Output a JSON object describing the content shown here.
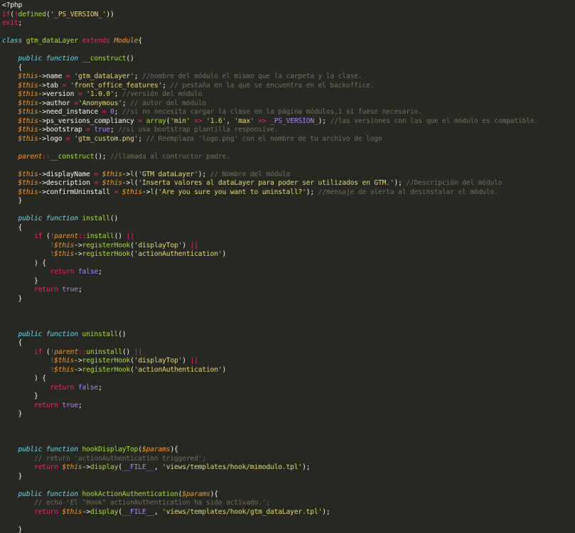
{
  "editor": {
    "theme": {
      "background": "#272822",
      "keyword": "#F92672",
      "storage": "#66D9EF",
      "function": "#A6E22E",
      "variable": "#FD971F",
      "string": "#E6DB74",
      "comment": "#75715E",
      "constant": "#AE81FF",
      "text": "#F8F8F2"
    },
    "lines": [
      [
        [
          "txt",
          "<?php"
        ]
      ],
      [
        [
          "kw",
          "if"
        ],
        [
          "txt",
          "("
        ],
        [
          "kw",
          "!"
        ],
        [
          "fn",
          "defined"
        ],
        [
          "txt",
          "("
        ],
        [
          "str",
          "'_PS_VERSION_'"
        ],
        [
          "txt",
          "))"
        ]
      ],
      [
        [
          "kw",
          "exit"
        ],
        [
          "txt",
          ";"
        ]
      ],
      [],
      [
        [
          "kwi",
          "class "
        ],
        [
          "fn",
          "gtm_dataLayer"
        ],
        [
          "kw",
          " extends "
        ],
        [
          "var",
          "Module"
        ],
        [
          "txt",
          "{"
        ]
      ],
      [],
      [
        [
          "txt",
          "    "
        ],
        [
          "kwi",
          "public function "
        ],
        [
          "fn",
          "__construct"
        ],
        [
          "txt",
          "()"
        ]
      ],
      [
        [
          "txt",
          "    {"
        ]
      ],
      [
        [
          "txt",
          "    "
        ],
        [
          "var",
          "$this"
        ],
        [
          "txt",
          "->name "
        ],
        [
          "kw",
          "="
        ],
        [
          "txt",
          " "
        ],
        [
          "str",
          "'gtm_dataLayer'"
        ],
        [
          "txt",
          "; "
        ],
        [
          "cm",
          "//nombre del módulo el mismo que la carpeta y la clase."
        ]
      ],
      [
        [
          "txt",
          "    "
        ],
        [
          "var",
          "$this"
        ],
        [
          "txt",
          "->tab "
        ],
        [
          "kw",
          "="
        ],
        [
          "txt",
          " "
        ],
        [
          "str",
          "'front_office_features'"
        ],
        [
          "txt",
          "; "
        ],
        [
          "cm",
          "// pestaña en la que se encuentra en el backoffice."
        ]
      ],
      [
        [
          "txt",
          "    "
        ],
        [
          "var",
          "$this"
        ],
        [
          "txt",
          "->version "
        ],
        [
          "kw",
          "="
        ],
        [
          "txt",
          " "
        ],
        [
          "str",
          "'1.0.0'"
        ],
        [
          "txt",
          "; "
        ],
        [
          "cm",
          "//versión del módulo"
        ]
      ],
      [
        [
          "txt",
          "    "
        ],
        [
          "var",
          "$this"
        ],
        [
          "txt",
          "->author "
        ],
        [
          "kw",
          "="
        ],
        [
          "str",
          "'Anonymous'"
        ],
        [
          "txt",
          "; "
        ],
        [
          "cm",
          "// autor del módulo"
        ]
      ],
      [
        [
          "txt",
          "    "
        ],
        [
          "var",
          "$this"
        ],
        [
          "txt",
          "->need_instance "
        ],
        [
          "kw",
          "="
        ],
        [
          "txt",
          " "
        ],
        [
          "con",
          "0"
        ],
        [
          "txt",
          "; "
        ],
        [
          "cm",
          "//si no necesita cargar la clase en la página módulos,1 si fuese necesario."
        ]
      ],
      [
        [
          "txt",
          "    "
        ],
        [
          "var",
          "$this"
        ],
        [
          "txt",
          "->ps_versions_compliancy "
        ],
        [
          "kw",
          "="
        ],
        [
          "txt",
          " "
        ],
        [
          "fn",
          "array"
        ],
        [
          "txt",
          "("
        ],
        [
          "str",
          "'min'"
        ],
        [
          "txt",
          " "
        ],
        [
          "kw",
          "=>"
        ],
        [
          "txt",
          " "
        ],
        [
          "str",
          "'1.6'"
        ],
        [
          "txt",
          ", "
        ],
        [
          "str",
          "'max'"
        ],
        [
          "txt",
          " "
        ],
        [
          "kw",
          "=>"
        ],
        [
          "txt",
          " "
        ],
        [
          "con",
          "_PS_VERSION_"
        ],
        [
          "txt",
          "); "
        ],
        [
          "cm",
          "//las versiones con las que el módulo es compatible."
        ]
      ],
      [
        [
          "txt",
          "    "
        ],
        [
          "var",
          "$this"
        ],
        [
          "txt",
          "->bootstrap "
        ],
        [
          "kw",
          "="
        ],
        [
          "txt",
          " "
        ],
        [
          "con",
          "true"
        ],
        [
          "txt",
          "; "
        ],
        [
          "cm",
          "//si usa bootstrap plantilla responsive."
        ]
      ],
      [
        [
          "txt",
          "    "
        ],
        [
          "var",
          "$this"
        ],
        [
          "txt",
          "->logo "
        ],
        [
          "kw",
          "="
        ],
        [
          "txt",
          " "
        ],
        [
          "str",
          "'gtm_custom.png'"
        ],
        [
          "txt",
          "; "
        ],
        [
          "cm",
          "// Reemplaza 'logo.png' con el nombre de tu archivo de logo"
        ]
      ],
      [],
      [
        [
          "txt",
          "    "
        ],
        [
          "var",
          "parent"
        ],
        [
          "kw",
          "::"
        ],
        [
          "fn",
          "__construct"
        ],
        [
          "txt",
          "(); "
        ],
        [
          "cm",
          "//llamada al contructor padre."
        ]
      ],
      [],
      [
        [
          "txt",
          "    "
        ],
        [
          "var",
          "$this"
        ],
        [
          "txt",
          "->displayName "
        ],
        [
          "kw",
          "="
        ],
        [
          "txt",
          " "
        ],
        [
          "var",
          "$this"
        ],
        [
          "txt",
          "->"
        ],
        [
          "fn",
          "l"
        ],
        [
          "txt",
          "("
        ],
        [
          "str",
          "'GTM dataLayer'"
        ],
        [
          "txt",
          "); "
        ],
        [
          "cm",
          "// Nombre del módulo"
        ]
      ],
      [
        [
          "txt",
          "    "
        ],
        [
          "var",
          "$this"
        ],
        [
          "txt",
          "->description "
        ],
        [
          "kw",
          "="
        ],
        [
          "txt",
          " "
        ],
        [
          "var",
          "$this"
        ],
        [
          "txt",
          "->"
        ],
        [
          "fn",
          "l"
        ],
        [
          "txt",
          "("
        ],
        [
          "str",
          "'Inserta valores al dataLayer para poder ser utilizados en GTM.'"
        ],
        [
          "txt",
          "); "
        ],
        [
          "cm",
          "//Descripción del módulo"
        ]
      ],
      [
        [
          "txt",
          "    "
        ],
        [
          "var",
          "$this"
        ],
        [
          "txt",
          "->confirmUninstall "
        ],
        [
          "kw",
          "="
        ],
        [
          "txt",
          " "
        ],
        [
          "var",
          "$this"
        ],
        [
          "txt",
          "->"
        ],
        [
          "fn",
          "l"
        ],
        [
          "txt",
          "("
        ],
        [
          "str",
          "'Are you sure you want to uninstall?'"
        ],
        [
          "txt",
          "); "
        ],
        [
          "cm",
          "//mensaje de alerta al desinstalar el módulo."
        ]
      ],
      [
        [
          "txt",
          "    }"
        ]
      ],
      [],
      [
        [
          "txt",
          "    "
        ],
        [
          "kwi",
          "public function "
        ],
        [
          "fn",
          "install"
        ],
        [
          "txt",
          "()"
        ]
      ],
      [
        [
          "txt",
          "    {"
        ]
      ],
      [
        [
          "txt",
          "        "
        ],
        [
          "kw",
          "if"
        ],
        [
          "txt",
          " ("
        ],
        [
          "kw",
          "!"
        ],
        [
          "var",
          "parent"
        ],
        [
          "kw",
          "::"
        ],
        [
          "fn",
          "install"
        ],
        [
          "txt",
          "() "
        ],
        [
          "kw",
          "||"
        ]
      ],
      [
        [
          "txt",
          "            "
        ],
        [
          "kw",
          "!"
        ],
        [
          "var",
          "$this"
        ],
        [
          "txt",
          "->"
        ],
        [
          "fn",
          "registerHook"
        ],
        [
          "txt",
          "("
        ],
        [
          "str",
          "'displayTop'"
        ],
        [
          "txt",
          ") "
        ],
        [
          "kw",
          "||"
        ]
      ],
      [
        [
          "txt",
          "            "
        ],
        [
          "kw",
          "!"
        ],
        [
          "var",
          "$this"
        ],
        [
          "txt",
          "->"
        ],
        [
          "fn",
          "registerHook"
        ],
        [
          "txt",
          "("
        ],
        [
          "str",
          "'actionAuthentication'"
        ],
        [
          "txt",
          ")"
        ]
      ],
      [
        [
          "txt",
          "        ) {"
        ]
      ],
      [
        [
          "txt",
          "            "
        ],
        [
          "kw",
          "return"
        ],
        [
          "txt",
          " "
        ],
        [
          "con",
          "false"
        ],
        [
          "txt",
          ";"
        ]
      ],
      [
        [
          "txt",
          "        }"
        ]
      ],
      [
        [
          "txt",
          "        "
        ],
        [
          "kw",
          "return"
        ],
        [
          "txt",
          " "
        ],
        [
          "con",
          "true"
        ],
        [
          "txt",
          ";"
        ]
      ],
      [
        [
          "txt",
          "    }"
        ]
      ],
      [],
      [],
      [],
      [
        [
          "txt",
          "    "
        ],
        [
          "kwi",
          "public function "
        ],
        [
          "fn",
          "uninstall"
        ],
        [
          "txt",
          "()"
        ]
      ],
      [
        [
          "txt",
          "    {"
        ]
      ],
      [
        [
          "txt",
          "        "
        ],
        [
          "kw",
          "if"
        ],
        [
          "txt",
          " ("
        ],
        [
          "kw",
          "!"
        ],
        [
          "var",
          "parent"
        ],
        [
          "kw",
          "::"
        ],
        [
          "fn",
          "uninstall"
        ],
        [
          "txt",
          "() "
        ],
        [
          "kw",
          "||"
        ]
      ],
      [
        [
          "txt",
          "            "
        ],
        [
          "kw",
          "!"
        ],
        [
          "var",
          "$this"
        ],
        [
          "txt",
          "->"
        ],
        [
          "fn",
          "registerHook"
        ],
        [
          "txt",
          "("
        ],
        [
          "str",
          "'displayTop'"
        ],
        [
          "txt",
          ") "
        ],
        [
          "kw",
          "||"
        ]
      ],
      [
        [
          "txt",
          "            "
        ],
        [
          "kw",
          "!"
        ],
        [
          "var",
          "$this"
        ],
        [
          "txt",
          "->"
        ],
        [
          "fn",
          "registerHook"
        ],
        [
          "txt",
          "("
        ],
        [
          "str",
          "'actionAuthentication'"
        ],
        [
          "txt",
          ")"
        ]
      ],
      [
        [
          "txt",
          "        ) {"
        ]
      ],
      [
        [
          "txt",
          "            "
        ],
        [
          "kw",
          "return"
        ],
        [
          "txt",
          " "
        ],
        [
          "con",
          "false"
        ],
        [
          "txt",
          ";"
        ]
      ],
      [
        [
          "txt",
          "        }"
        ]
      ],
      [
        [
          "txt",
          "        "
        ],
        [
          "kw",
          "return"
        ],
        [
          "txt",
          " "
        ],
        [
          "con",
          "true"
        ],
        [
          "txt",
          ";"
        ]
      ],
      [
        [
          "txt",
          "    }"
        ]
      ],
      [],
      [],
      [],
      [
        [
          "txt",
          "    "
        ],
        [
          "kwi",
          "public function "
        ],
        [
          "fn",
          "hookDisplayTop"
        ],
        [
          "txt",
          "("
        ],
        [
          "var",
          "$params"
        ],
        [
          "txt",
          "){"
        ]
      ],
      [
        [
          "txt",
          "        "
        ],
        [
          "cm",
          "// return 'actionAuthentication triggered';"
        ]
      ],
      [
        [
          "txt",
          "        "
        ],
        [
          "kw",
          "return"
        ],
        [
          "txt",
          " "
        ],
        [
          "var",
          "$this"
        ],
        [
          "txt",
          "->"
        ],
        [
          "fn",
          "display"
        ],
        [
          "txt",
          "("
        ],
        [
          "con",
          "__FILE__"
        ],
        [
          "txt",
          ", "
        ],
        [
          "str",
          "'views/templates/hook/mimodulo.tpl'"
        ],
        [
          "txt",
          ");"
        ]
      ],
      [
        [
          "txt",
          "    }"
        ]
      ],
      [],
      [
        [
          "txt",
          "    "
        ],
        [
          "kwi",
          "public function "
        ],
        [
          "fn",
          "hookActionAuthentication"
        ],
        [
          "txt",
          "("
        ],
        [
          "var",
          "$params"
        ],
        [
          "txt",
          "){"
        ]
      ],
      [
        [
          "txt",
          "        "
        ],
        [
          "cm",
          "// echo 'El \"Hook\" actionAuthentication ha sido activado.';"
        ]
      ],
      [
        [
          "txt",
          "        "
        ],
        [
          "kw",
          "return"
        ],
        [
          "txt",
          " "
        ],
        [
          "var",
          "$this"
        ],
        [
          "txt",
          "->"
        ],
        [
          "fn",
          "display"
        ],
        [
          "txt",
          "("
        ],
        [
          "con",
          "__FILE__"
        ],
        [
          "txt",
          ", "
        ],
        [
          "str",
          "'views/templates/hook/gtm_dataLayer.tpl'"
        ],
        [
          "txt",
          ");"
        ]
      ],
      [],
      [
        [
          "txt",
          "    }"
        ]
      ],
      [],
      [
        [
          "txt",
          "}"
        ]
      ]
    ]
  }
}
